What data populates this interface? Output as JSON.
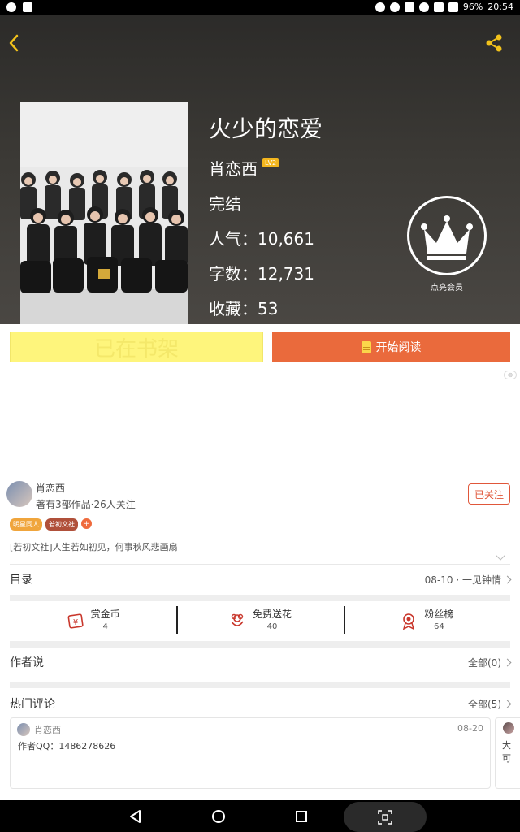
{
  "status_bar": {
    "battery": "96%",
    "time": "20:54"
  },
  "book": {
    "title": "火少的恋爱",
    "author": "肖恋西",
    "author_level": "LV2",
    "status": "完结",
    "popularity": "人气：10,661",
    "word_count": "字数：12,731",
    "favorites": "收藏：53"
  },
  "vip": {
    "label": "点亮会员"
  },
  "actions": {
    "shelf_label": "已在书架",
    "read_label": "开始阅读"
  },
  "ad": {
    "close_label": "⊗"
  },
  "author_card": {
    "name": "肖恋西",
    "subtitle": "著有3部作品·26人关注",
    "follow_label": "已关注",
    "tags": [
      {
        "label": "明星同人",
        "color": "#f0a53c"
      },
      {
        "label": "若初文社",
        "color": "#b0503a"
      },
      {
        "label": "+",
        "color": "#ef6a3c"
      }
    ],
    "intro": "[若初文社]人生若如初见，何事秋风悲画扇"
  },
  "catalog": {
    "label": "目录",
    "latest": "08-10 · 一见钟情"
  },
  "stats": [
    {
      "label": "赏金币",
      "count": "4",
      "icon": "coin-icon",
      "color": "#c9372c"
    },
    {
      "label": "免费送花",
      "count": "40",
      "icon": "flower-icon",
      "color": "#c9372c"
    },
    {
      "label": "粉丝榜",
      "count": "64",
      "icon": "medal-icon",
      "color": "#c9372c"
    }
  ],
  "author_says": {
    "label": "作者说",
    "all": "全部(0)"
  },
  "hot_comments": {
    "label": "热门评论",
    "all": "全部(5)",
    "items": [
      {
        "name": "肖恋西",
        "date": "08-20",
        "text": "作者QQ：1486278626"
      }
    ],
    "peek_text": "大\n可"
  }
}
